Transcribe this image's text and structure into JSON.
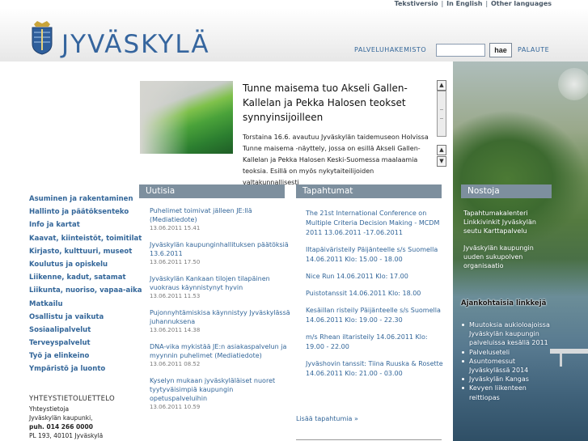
{
  "top_links": [
    "Tekstiversio",
    "In English",
    "Other languages"
  ],
  "top_links_separator": "|",
  "logo": {
    "text": "JYVÄSKYLÄ"
  },
  "search": {
    "label": "PALVELUHAKEMISTO",
    "placeholder": "",
    "button": "hae",
    "feedback": "PALAUTE"
  },
  "feature": {
    "title": "Tunne maisema tuo Akseli Gallen-Kallelan ja Pekka Halosen teokset synnyinsijoilleen",
    "text": "Torstaina 16.6. avautuu Jyväskylän taidemuseon Holvissa Tunne maisema -näyttely, jossa on esillä Akseli Gallen-Kallelan ja Pekka Halosen Keski-Suomessa maalaamia teoksia. Esillä on myös nykytaiteilijoiden valtakunnallisesti"
  },
  "nav": [
    "Asuminen ja rakentaminen",
    "Hallinto ja päätöksenteko",
    "Info ja kartat",
    "Kaavat, kiinteistöt, toimitilat",
    "Kirjasto, kulttuuri, museot",
    "Koulutus ja opiskelu",
    "Liikenne, kadut, satamat",
    "Liikunta, nuoriso, vapaa-aika",
    "Matkailu",
    "Osallistu ja vaikuta",
    "Sosiaalipalvelut",
    "Terveyspalvelut",
    "Työ ja elinkeino",
    "Ympäristö ja luonto"
  ],
  "contact": {
    "title": "YHTEYSTIETOLUETTELO",
    "lines": [
      "Yhteystietoja",
      "Jyväskylän kaupunki,"
    ],
    "phone": "puh. 014 266 0000",
    "address": "PL 193, 40101 Jyväskylä"
  },
  "columns": {
    "news": "Uutisia",
    "events": "Tapahtumat",
    "picks": "Nostoja"
  },
  "news": [
    {
      "title": "Puhelimet toimivat jälleen JE:llä (Mediatiedote)",
      "date": "13.06.2011 15.41"
    },
    {
      "title": "Jyväskylän kaupunginhallituksen päätöksiä 13.6.2011",
      "date": "13.06.2011 17.50"
    },
    {
      "title": "Jyväskylän Kankaan tilojen tilapäinen vuokraus käynnistynyt hyvin",
      "date": "13.06.2011 11.53"
    },
    {
      "title": "Pujonnyhtämiskisa käynnistyy Jyväskylässä juhannuksena",
      "date": "13.06.2011 14.38"
    },
    {
      "title": "DNA-vika mykistää JE:n asiakaspalvelun ja myynnin puhelimet (Mediatiedote)",
      "date": "13.06.2011 08.52"
    },
    {
      "title": "Kyselyn mukaan jyväskyläläiset nuoret tyytyväisimpiä kaupungin opetuspalveluihin",
      "date": "13.06.2011 10.59"
    }
  ],
  "events": [
    "The 21st International Conference on Multiple Criteria Decision Making - MCDM 2011 13.06.2011 -17.06.2011",
    "Iltapäiväristeily Päijänteelle s/s Suomella 14.06.2011 Klo: 15.00 - 18.00",
    "Nice Run 14.06.2011 Klo: 17.00",
    "Puistotanssit 14.06.2011 Klo: 18.00",
    "Kesäillan risteily Päijänteelle s/s Suomella 14.06.2011 Klo: 19.00 - 22.30",
    "m/s Rhean iltaristeily 14.06.2011 Klo: 19.00 - 22.00",
    "Jyväshovin tanssit: Tiina Ruuska & Rosette 14.06.2011 Klo: 21.00 - 03.00"
  ],
  "more_events": "Lisää tapahtumia »",
  "picks": [
    "Tapahtumakalenteri Linkkivinkit Jyväskylän seutu Karttapalvelu",
    "Jyväskylän kaupungin uuden sukupolven organisaatio"
  ],
  "links_heading": "Ajankohtaisia linkkejä",
  "links": [
    "Muutoksia aukioloajoissa Jyväskylän kaupungin palveluissa kesällä 2011",
    "Palveluseteli",
    "Asuntomessut Jyväskylässä 2014",
    "Jyväskylän Kangas",
    "Kevyen liikenteen reittiopas"
  ],
  "colors": {
    "accent": "#336699",
    "header_bar": "#7d8f9e",
    "logo": "#35659e"
  }
}
